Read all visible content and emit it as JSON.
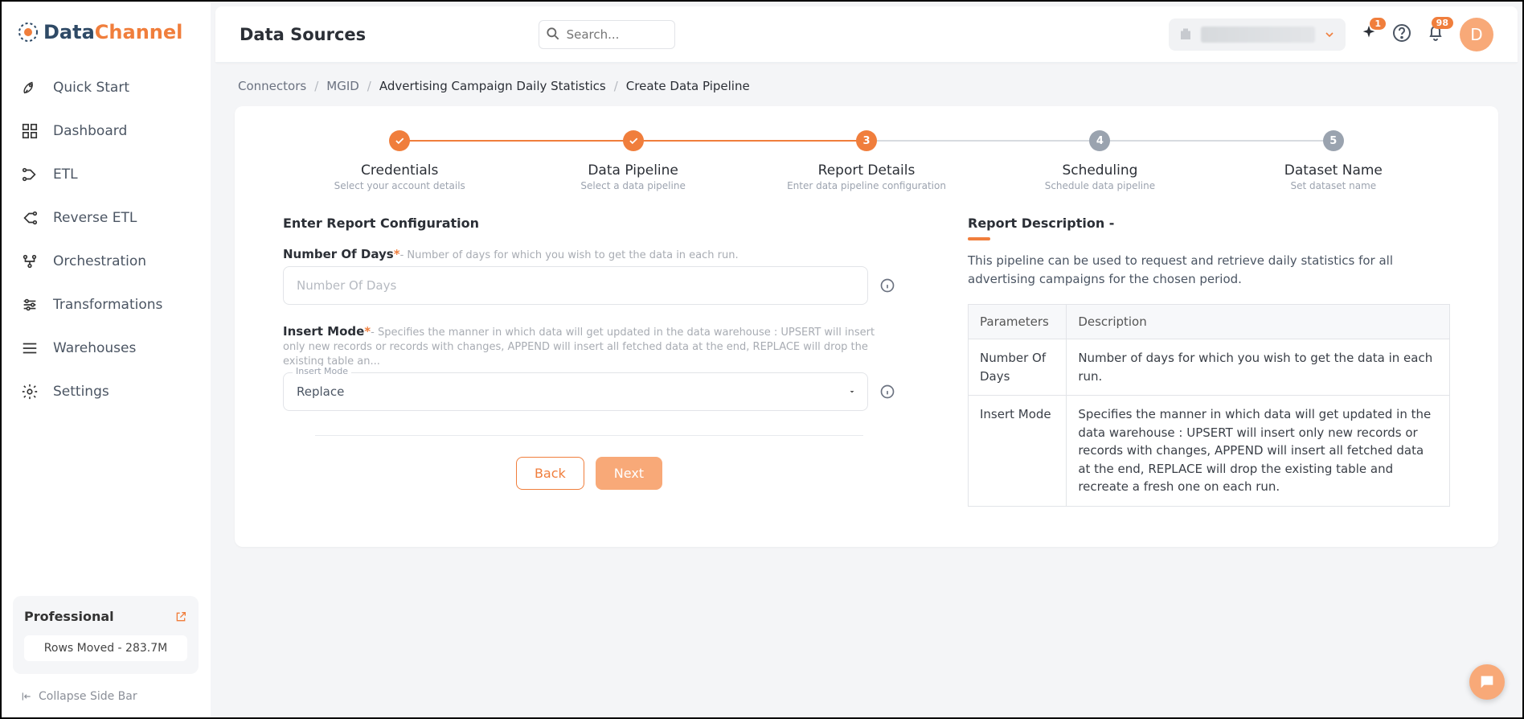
{
  "brand": {
    "part1": "Data",
    "part2": "Channel"
  },
  "sidebar": {
    "items": [
      {
        "label": "Quick Start"
      },
      {
        "label": "Dashboard"
      },
      {
        "label": "ETL"
      },
      {
        "label": "Reverse ETL"
      },
      {
        "label": "Orchestration"
      },
      {
        "label": "Transformations"
      },
      {
        "label": "Warehouses"
      },
      {
        "label": "Settings"
      }
    ],
    "plan": {
      "name": "Professional",
      "rows": "Rows Moved - 283.7M"
    },
    "collapse": "Collapse Side Bar"
  },
  "header": {
    "title": "Data Sources",
    "search_placeholder": "Search...",
    "ai_badge": "1",
    "bell_badge": "98",
    "avatar_initial": "D"
  },
  "breadcrumbs": [
    "Connectors",
    "MGID",
    "Advertising Campaign Daily Statistics",
    "Create Data Pipeline"
  ],
  "steps": [
    {
      "title": "Credentials",
      "sub": "Select your account details",
      "state": "done"
    },
    {
      "title": "Data Pipeline",
      "sub": "Select a data pipeline",
      "state": "done"
    },
    {
      "title": "Report Details",
      "sub": "Enter data pipeline configuration",
      "state": "active",
      "num": "3"
    },
    {
      "title": "Scheduling",
      "sub": "Schedule data pipeline",
      "state": "todo",
      "num": "4"
    },
    {
      "title": "Dataset Name",
      "sub": "Set dataset name",
      "state": "todo",
      "num": "5"
    }
  ],
  "form": {
    "section_title": "Enter Report Configuration",
    "days": {
      "label": "Number Of Days",
      "hint": "- Number of days for which you wish to get the data in each run.",
      "placeholder": "Number Of Days"
    },
    "insert": {
      "label": "Insert Mode",
      "hint": "- Specifies the manner in which data will get updated in the data warehouse : UPSERT will insert only new records or records with changes, APPEND will insert all fetched data at the end, REPLACE will drop the existing table an...",
      "float": "Insert Mode",
      "value": "Replace"
    },
    "back": "Back",
    "next": "Next"
  },
  "desc": {
    "title": "Report Description -",
    "text": "This pipeline can be used to request and retrieve daily statistics for all advertising campaigns for the chosen period.",
    "th1": "Parameters",
    "th2": "Description",
    "rows": [
      {
        "p": "Number Of Days",
        "d": "Number of days for which you wish to get the data in each run."
      },
      {
        "p": "Insert Mode",
        "d": "Specifies the manner in which data will get updated in the data warehouse : UPSERT will insert only new records or records with changes, APPEND will insert all fetched data at the end, REPLACE will drop the existing table and recreate a fresh one on each run."
      }
    ]
  }
}
